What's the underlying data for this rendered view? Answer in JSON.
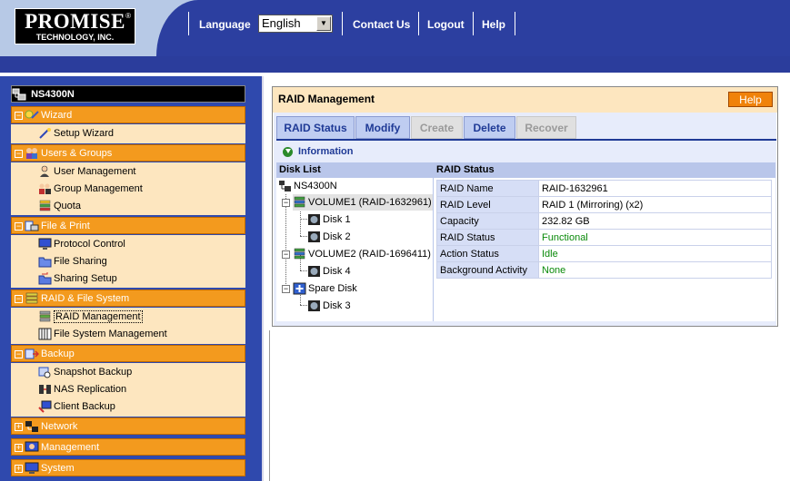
{
  "logo": {
    "name": "PROMISE",
    "registered": "®",
    "sub": "TECHNOLOGY, INC."
  },
  "topnav": {
    "language_label": "Language",
    "language_value": "English",
    "contact": "Contact Us",
    "logout": "Logout",
    "help": "Help"
  },
  "sidebar": {
    "root": "NS4300N",
    "groups": [
      {
        "label": "Wizard",
        "items": [
          "Setup Wizard"
        ]
      },
      {
        "label": "Users & Groups",
        "items": [
          "User Management",
          "Group Management",
          "Quota"
        ]
      },
      {
        "label": "File & Print",
        "items": [
          "Protocol Control",
          "File Sharing",
          "Sharing Setup"
        ]
      },
      {
        "label": "RAID & File System",
        "items": [
          "RAID Management",
          "File System Management"
        ]
      },
      {
        "label": "Backup",
        "items": [
          "Snapshot Backup",
          "NAS Replication",
          "Client Backup"
        ]
      },
      {
        "label": "Network",
        "items": []
      },
      {
        "label": "Management",
        "items": []
      },
      {
        "label": "System",
        "items": []
      }
    ]
  },
  "panel": {
    "title": "RAID Management",
    "help": "Help",
    "tabs": [
      "RAID Status",
      "Modify",
      "Create",
      "Delete",
      "Recover"
    ],
    "info": "Information",
    "disk_list_header": "Disk List",
    "status_header": "RAID Status",
    "tree": {
      "root": "NS4300N",
      "volume1": "VOLUME1 (RAID-1632961)",
      "v1_disks": [
        "Disk 1",
        "Disk 2"
      ],
      "volume2": "VOLUME2 (RAID-1696411)",
      "v2_disks": [
        "Disk 4"
      ],
      "spare": "Spare Disk",
      "spare_disks": [
        "Disk 3"
      ]
    },
    "status_rows": [
      {
        "key": "RAID Name",
        "value": "RAID-1632961"
      },
      {
        "key": "RAID Level",
        "value": "RAID 1 (Mirroring) (x2)"
      },
      {
        "key": "Capacity",
        "value": "232.82 GB"
      },
      {
        "key": "RAID Status",
        "value": "Functional"
      },
      {
        "key": "Action Status",
        "value": "Idle"
      },
      {
        "key": "Background Activity",
        "value": "None"
      }
    ]
  },
  "colors": {
    "accent_orange": "#f39a1e",
    "nav_blue": "#2c3fa0",
    "sidebar_blue": "#2f49ad",
    "ok_green": "#0a8a0a"
  }
}
